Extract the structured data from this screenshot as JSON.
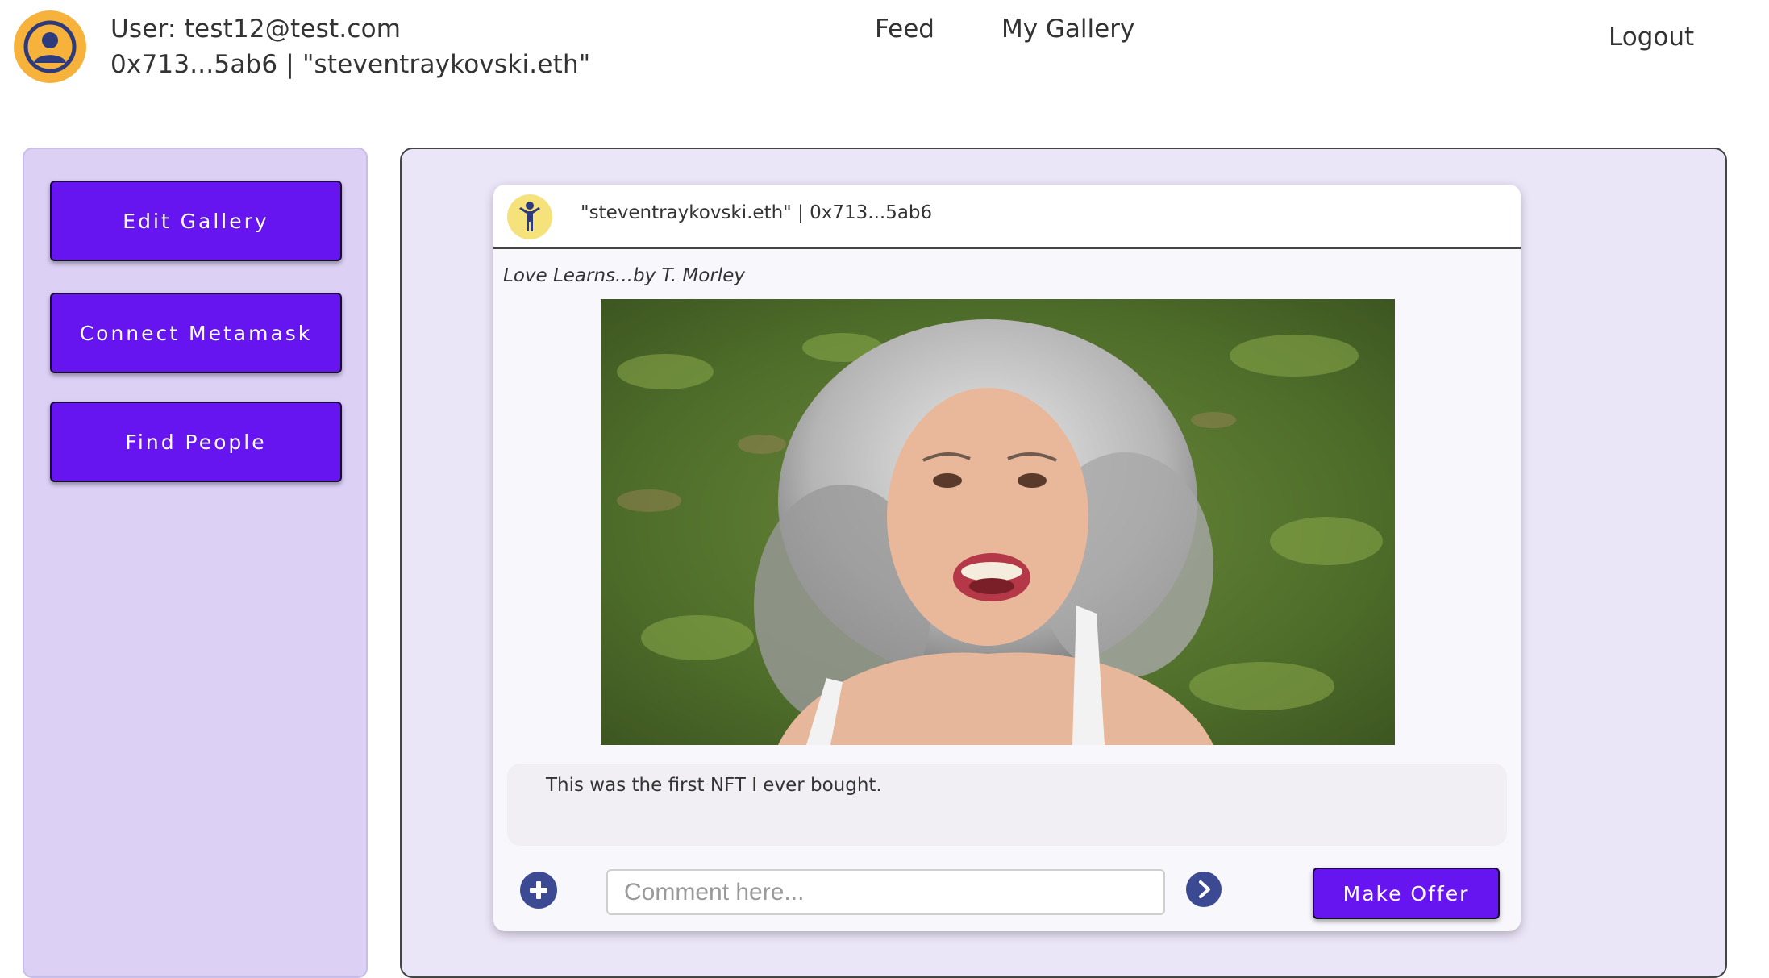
{
  "header": {
    "user_email": "User: test12@test.com",
    "user_wallet": "0x713...5ab6 | \"steventraykovski.eth\"",
    "nav": [
      {
        "label": "Feed"
      },
      {
        "label": "My Gallery"
      }
    ],
    "logout_label": "Logout",
    "avatar_icon": "user-circle-icon"
  },
  "sidebar": {
    "buttons": [
      {
        "label": "Edit Gallery"
      },
      {
        "label": "Connect Metamask"
      },
      {
        "label": "Find People"
      }
    ]
  },
  "post": {
    "owner_icon": "person-arms-up-icon",
    "owner_line": "\"steventraykovski.eth\"  |  0x713...5ab6",
    "title": "Love Learns...by T. Morley",
    "image_icon": "nft-photo",
    "caption": "This was the first NFT I ever bought.",
    "comment_placeholder": "Comment here...",
    "comment_value": "",
    "add_icon": "plus-circle-icon",
    "send_icon": "chevron-right-circle-icon",
    "offer_label": "Make Offer"
  },
  "colors": {
    "accent": "#6614f0",
    "sidebar_bg": "#dcd0f5",
    "panel_bg": "#ebe5f8",
    "avatar": "#f6b23b",
    "icon_blue": "#3c4a94"
  }
}
